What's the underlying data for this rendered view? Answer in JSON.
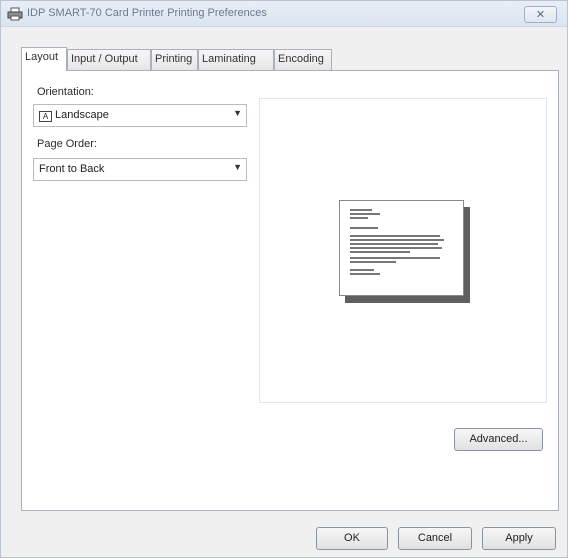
{
  "window": {
    "title": "IDP SMART-70 Card Printer Printing Preferences",
    "close_glyph": "✕"
  },
  "tabs": [
    {
      "label": "Layout",
      "active": true
    },
    {
      "label": "Input / Output",
      "active": false
    },
    {
      "label": "Printing",
      "active": false
    },
    {
      "label": "Laminating",
      "active": false
    },
    {
      "label": "Encoding",
      "active": false
    }
  ],
  "layout": {
    "orientation_label": "Orientation:",
    "orientation_value": "Landscape",
    "orientation_icon_glyph": "A",
    "page_order_label": "Page Order:",
    "page_order_value": "Front to Back",
    "dropdown_arrow": "▼",
    "advanced_label": "Advanced..."
  },
  "footer": {
    "ok_label": "OK",
    "cancel_label": "Cancel",
    "apply_label": "Apply"
  },
  "icons": {
    "title": "printer-icon",
    "close": "close-icon",
    "orientation": "landscape-orientation-icon",
    "dropdown": "chevron-down-icon"
  }
}
